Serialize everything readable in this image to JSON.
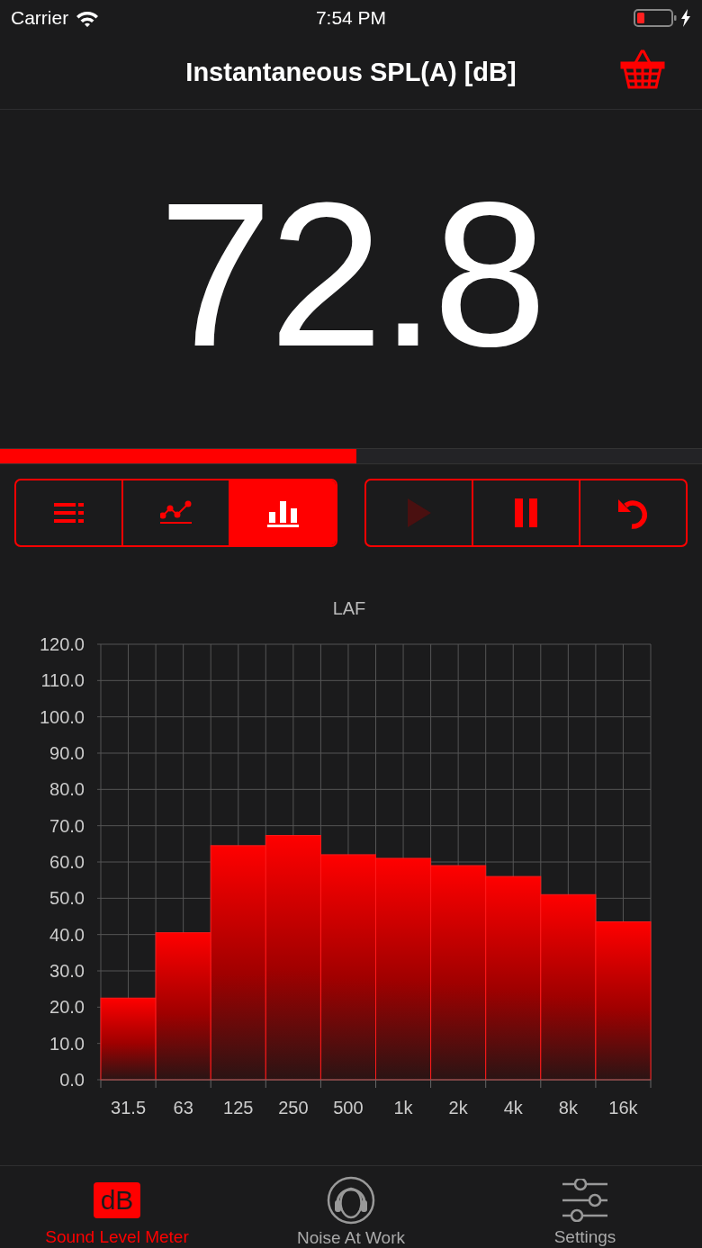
{
  "status_bar": {
    "carrier": "Carrier",
    "time": "7:54 PM"
  },
  "nav": {
    "title": "Instantaneous SPL(A) [dB]"
  },
  "reading": {
    "value": "72.8",
    "level": 0.508
  },
  "view_modes": [
    {
      "kind": "list",
      "selected": false
    },
    {
      "kind": "line",
      "selected": false
    },
    {
      "kind": "bars",
      "selected": true
    }
  ],
  "playback": [
    {
      "kind": "play",
      "disabled": true
    },
    {
      "kind": "pause",
      "disabled": false
    },
    {
      "kind": "reset",
      "disabled": false
    }
  ],
  "spectrum": {
    "chart_data": {
      "type": "bar",
      "grid": true,
      "title": "LAF",
      "categories": [
        "31.5",
        "63",
        "125",
        "250",
        "500",
        "1k",
        "2k",
        "4k",
        "8k",
        "16k"
      ],
      "values": [
        22.5,
        40.5,
        64.5,
        67.3,
        62,
        61,
        59,
        56,
        51,
        43.5
      ],
      "ylim": [
        0,
        120
      ],
      "yticks": [
        {
          "value": 0,
          "label": "0.0"
        },
        {
          "value": 10,
          "label": "10.0"
        },
        {
          "value": 20,
          "label": "20.0"
        },
        {
          "value": 30,
          "label": "30.0"
        },
        {
          "value": 40,
          "label": "40.0"
        },
        {
          "value": 50,
          "label": "50.0"
        },
        {
          "value": 60,
          "label": "60.0"
        },
        {
          "value": 70,
          "label": "70.0"
        },
        {
          "value": 80,
          "label": "80.0"
        },
        {
          "value": 90,
          "label": "90.0"
        },
        {
          "value": 100,
          "label": "100.0"
        },
        {
          "value": 110,
          "label": "110.0"
        },
        {
          "value": 120,
          "label": "120.0"
        }
      ]
    }
  },
  "tabs": [
    {
      "kind": "meter",
      "badge": "dB",
      "label": "Sound Level Meter",
      "selected": true
    },
    {
      "kind": "work",
      "label": "Noise At Work",
      "selected": false
    },
    {
      "kind": "settings",
      "label": "Settings",
      "selected": false
    }
  ]
}
